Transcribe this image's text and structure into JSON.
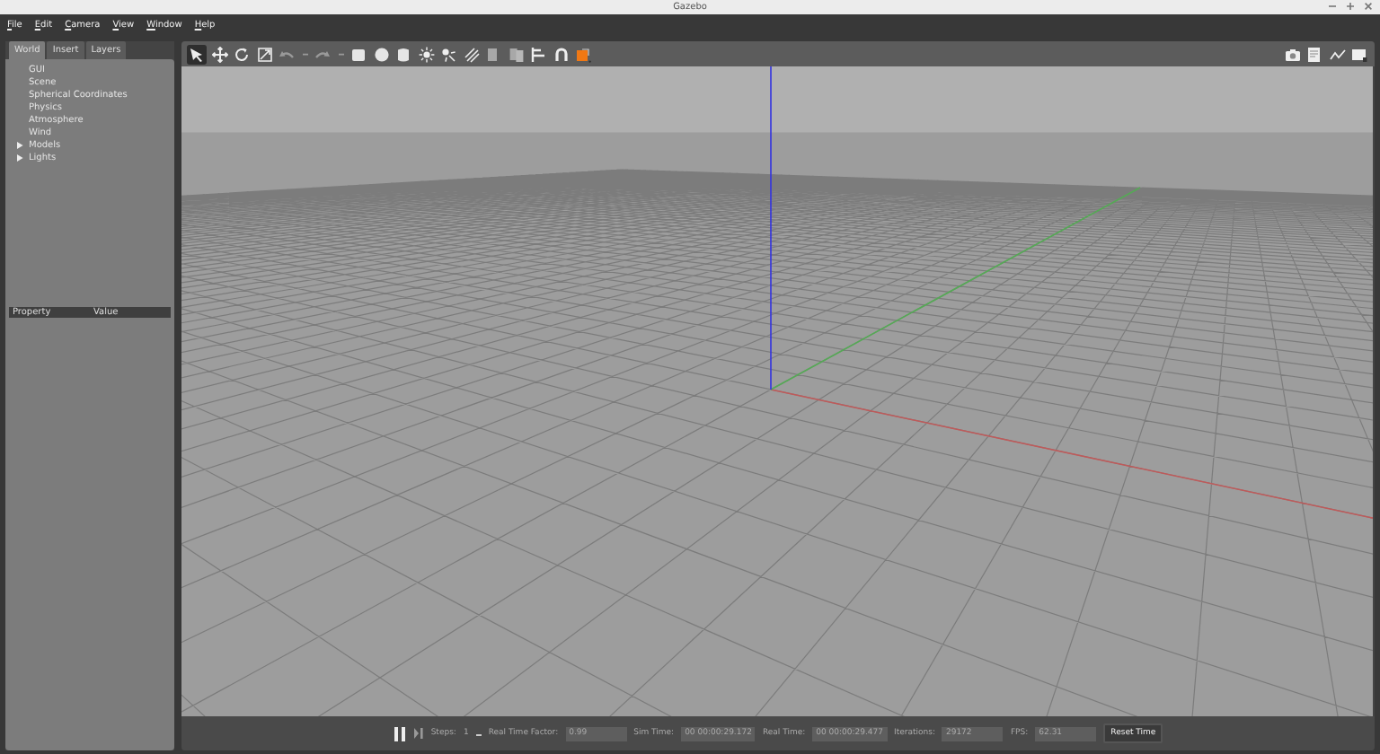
{
  "window": {
    "title": "Gazebo"
  },
  "menu": [
    "File",
    "Edit",
    "Camera",
    "View",
    "Window",
    "Help"
  ],
  "left_panel": {
    "tabs": [
      {
        "label": "World",
        "selected": true
      },
      {
        "label": "Insert",
        "selected": false
      },
      {
        "label": "Layers",
        "selected": false
      }
    ],
    "tree": [
      {
        "label": "GUI"
      },
      {
        "label": "Scene"
      },
      {
        "label": "Spherical Coordinates"
      },
      {
        "label": "Physics"
      },
      {
        "label": "Atmosphere"
      },
      {
        "label": "Wind"
      },
      {
        "label": "Models",
        "expanded": false
      },
      {
        "label": "Lights",
        "expanded": false
      }
    ],
    "property_table": {
      "columns": [
        "Property",
        "Value"
      ]
    }
  },
  "toolbar": {
    "tools": [
      {
        "kind": "select",
        "selected": true
      },
      {
        "kind": "translate",
        "selected": false
      },
      {
        "kind": "rotate",
        "selected": false
      },
      {
        "kind": "scale",
        "selected": false
      },
      {
        "kind": "undo",
        "selected": false
      },
      {
        "kind": "dropdown",
        "selected": false
      },
      {
        "kind": "redo",
        "selected": false
      },
      {
        "kind": "dropdown",
        "selected": false
      },
      {
        "kind": "box",
        "selected": false
      },
      {
        "kind": "sphere",
        "selected": false
      },
      {
        "kind": "cylinder",
        "selected": false
      },
      {
        "kind": "sun",
        "selected": false
      },
      {
        "kind": "pointlight",
        "selected": false
      },
      {
        "kind": "spotlight",
        "selected": false
      },
      {
        "kind": "copy",
        "selected": false
      },
      {
        "kind": "paste",
        "selected": false
      },
      {
        "kind": "align",
        "selected": false
      },
      {
        "kind": "magnet",
        "selected": false
      },
      {
        "kind": "view",
        "selected": false
      }
    ],
    "right_tools": [
      {
        "kind": "camera"
      },
      {
        "kind": "log"
      },
      {
        "kind": "plot"
      },
      {
        "kind": "video"
      }
    ]
  },
  "bottom_bar": {
    "steps_label": "Steps:",
    "steps_value": "1",
    "fields": [
      {
        "label": "Real Time Factor:",
        "value": "0.99"
      },
      {
        "label": "Sim Time:",
        "value": "00 00:00:29.172"
      },
      {
        "label": "Real Time:",
        "value": "00 00:00:29.477"
      },
      {
        "label": "Iterations:",
        "value": "29172"
      },
      {
        "label": "FPS:",
        "value": "62.31"
      }
    ],
    "reset_button": "Reset Time"
  }
}
